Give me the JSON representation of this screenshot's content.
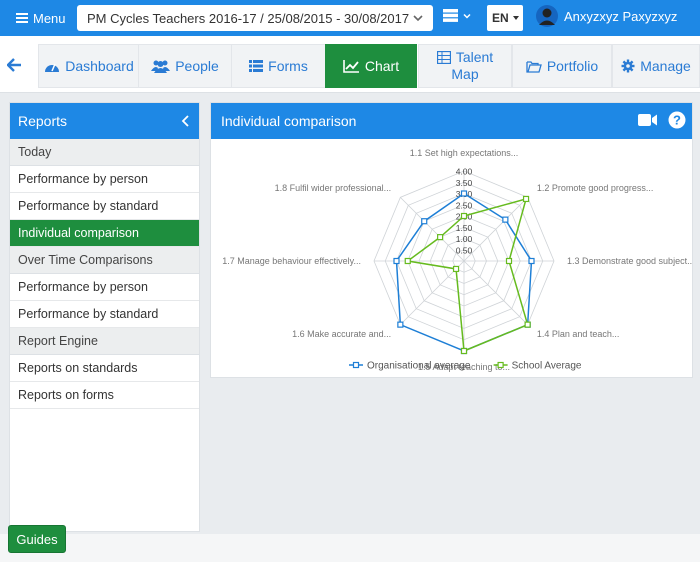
{
  "topbar": {
    "menu_label": "Menu",
    "cycle_select_value": "PM Cycles Teachers 2016-17 / 25/08/2015 - 30/08/2017",
    "language": "EN",
    "user_name": "Anxyzxyz Paxyzxyz"
  },
  "nav": {
    "items": [
      {
        "label": "Dashboard",
        "icon": "dashboard-icon"
      },
      {
        "label": "People",
        "icon": "people-icon"
      },
      {
        "label": "Forms",
        "icon": "list-icon"
      },
      {
        "label": "Chart",
        "icon": "line-chart-icon"
      },
      {
        "label_line1": "Talent",
        "label_line2": "Map",
        "icon": "table-icon"
      },
      {
        "label": "Portfolio",
        "icon": "folder-icon"
      },
      {
        "label": "Manage",
        "icon": "gear-icon"
      }
    ],
    "active": "Chart"
  },
  "sidebar": {
    "title": "Reports",
    "groups": [
      {
        "label": "Today",
        "items": [
          "Performance by person",
          "Performance by standard",
          "Individual comparison"
        ]
      },
      {
        "label": "Over Time Comparisons",
        "items": [
          "Performance by person",
          "Performance by standard"
        ]
      },
      {
        "label": "Report Engine",
        "items": [
          "Reports on standards",
          "Reports on forms"
        ]
      }
    ],
    "active_item": "Individual comparison"
  },
  "panel": {
    "title": "Individual comparison"
  },
  "chart_data": {
    "type": "radar",
    "title": "",
    "categories": [
      "1.1 Set high expectations...",
      "1.2 Promote good progress...",
      "1.3 Demonstrate good subject...",
      "1.4 Plan and teach...",
      "1.5 Adapt teaching to...",
      "1.6 Make accurate and...",
      "1.7 Manage behaviour effectively...",
      "1.8 Fulfil wider professional..."
    ],
    "ticks": [
      "0.50",
      "1.00",
      "1.50",
      "2.00",
      "2.50",
      "3.00",
      "3.50",
      "4.00"
    ],
    "rmax": 4,
    "series": [
      {
        "name": "Organisational average",
        "color": "#1e7fd6",
        "values": [
          3.0,
          2.6,
          3.0,
          4.0,
          4.0,
          4.0,
          3.0,
          2.5
        ]
      },
      {
        "name": "School Average",
        "color": "#66bb1f",
        "values": [
          2.0,
          3.9,
          2.0,
          4.0,
          4.0,
          0.5,
          2.5,
          1.5
        ]
      }
    ],
    "legend_position": "bottom"
  },
  "guides_label": "Guides"
}
